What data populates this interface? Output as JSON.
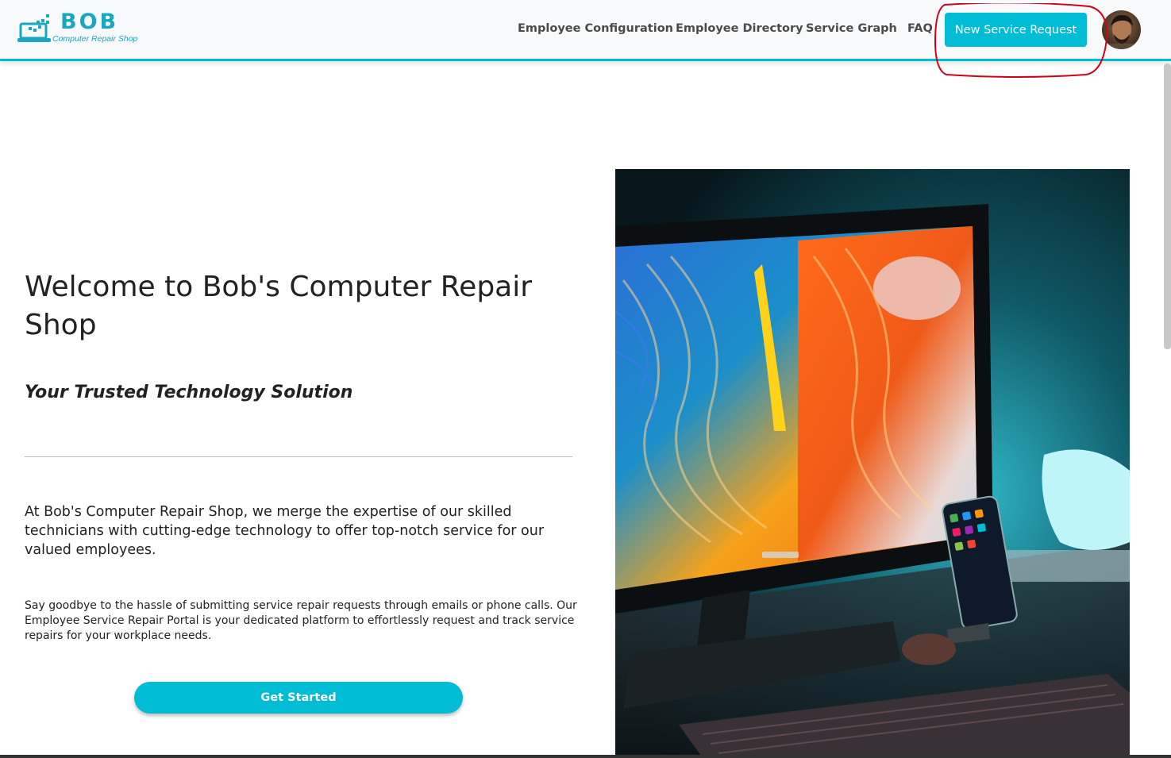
{
  "brand": {
    "name": "BOB",
    "tagline": "Computer Repair Shop",
    "color": "#1aa7c2"
  },
  "nav": {
    "links": [
      {
        "label": "Employee Configuration"
      },
      {
        "label": "Employee Directory"
      },
      {
        "label": "Service Graph"
      },
      {
        "label": "FAQ"
      }
    ],
    "cta_label": "New Service Request",
    "accent": "#00bcd4",
    "avatar_icon": "user-avatar"
  },
  "hero": {
    "title": "Welcome to Bob's Computer Repair Shop",
    "subtitle": "Your Trusted Technology Solution",
    "intro": "At Bob's Computer Repair Shop, we merge the expertise of our skilled technicians with cutting-edge technology to offer top-notch service for our valued employees.",
    "body": "Say goodbye to the hassle of submitting service repair requests through emails or phone calls. Our Employee Service Repair Portal is your dedicated platform to effortlessly request and track service repairs for your workplace needs.",
    "button_label": "Get Started",
    "image_icon": "desktop-computer-photo"
  }
}
